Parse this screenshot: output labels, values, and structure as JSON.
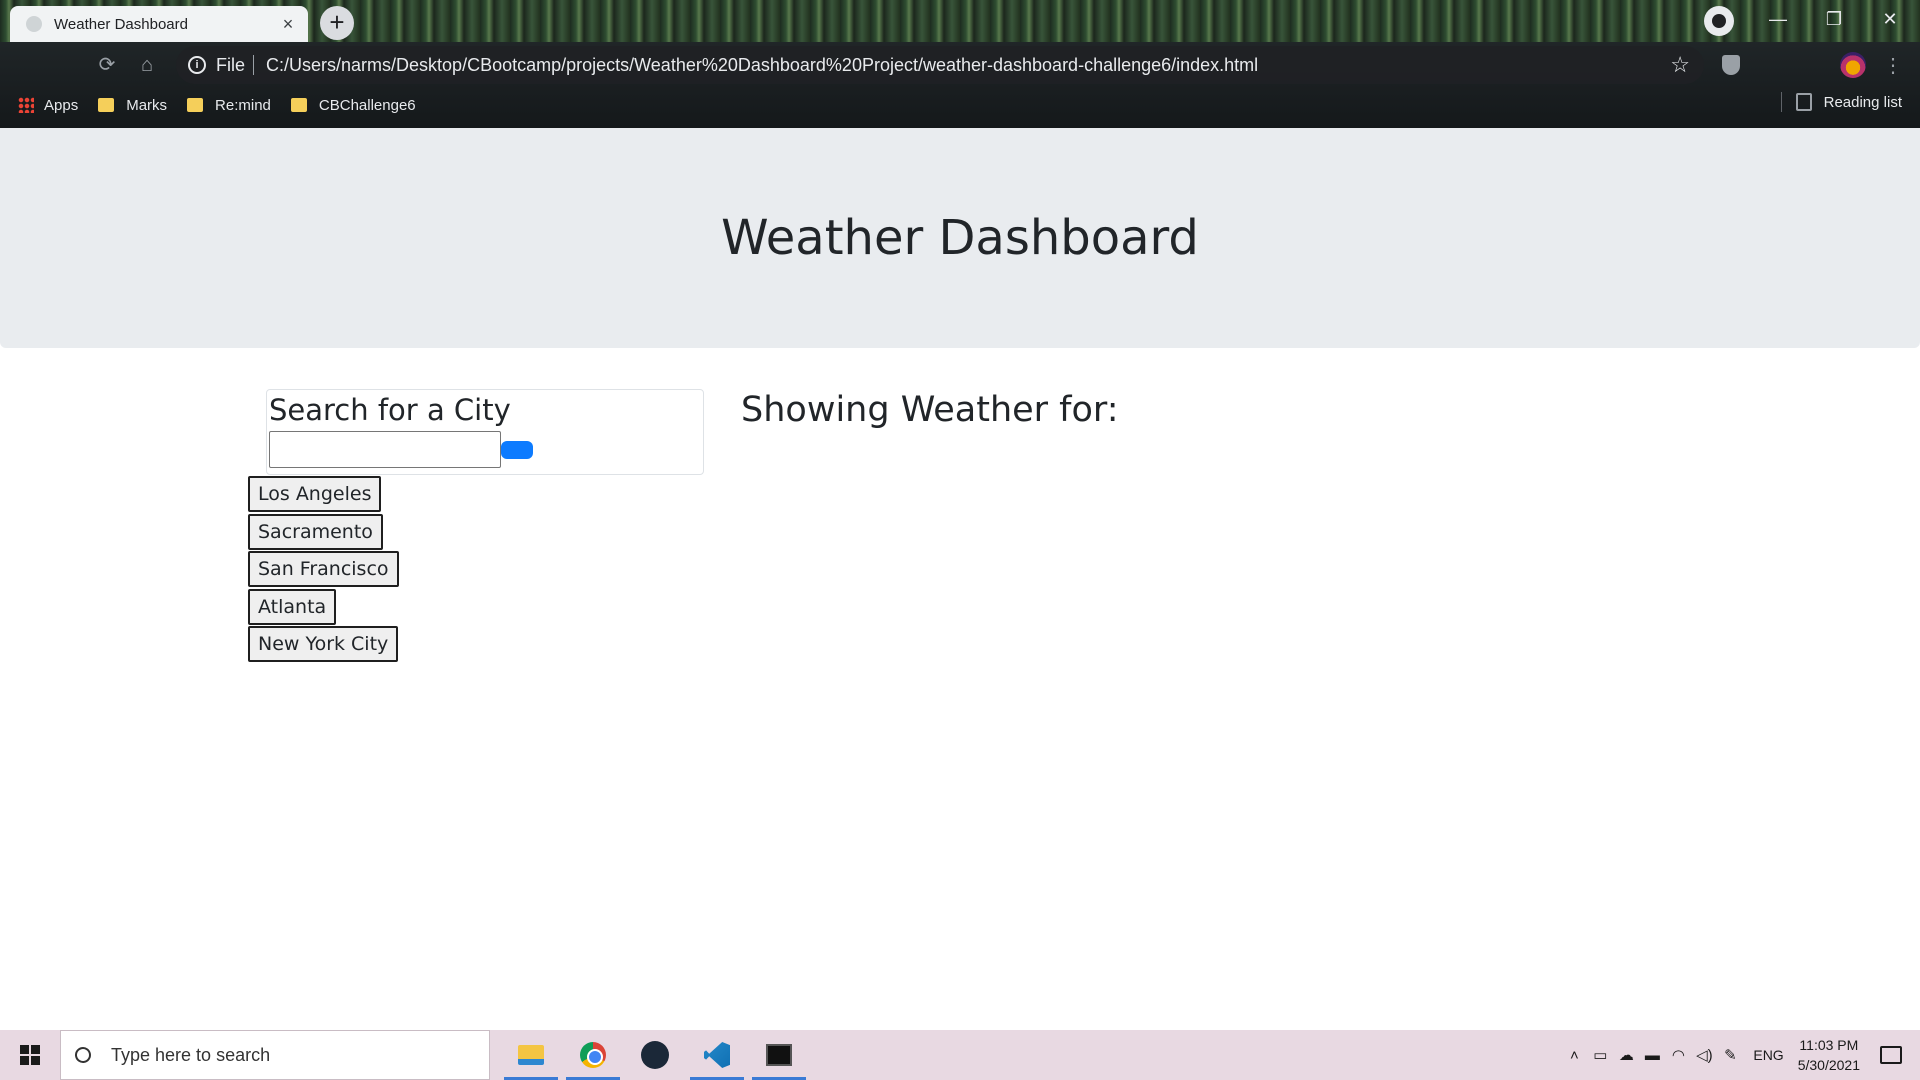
{
  "browser": {
    "tab_title": "Weather Dashboard",
    "tab_close": "×",
    "new_tab": "+",
    "scheme_label": "File",
    "url": "C:/Users/narms/Desktop/CBootcamp/projects/Weather%20Dashboard%20Project/weather-dashboard-challenge6/index.html",
    "bookmarks": [
      "Apps",
      "Marks",
      "Re:mind",
      "CBChallenge6"
    ],
    "reading_list": "Reading list",
    "window_controls": {
      "minimize": "—",
      "restore": "❐",
      "close": "✕"
    }
  },
  "page": {
    "title": "Weather Dashboard",
    "search": {
      "heading": "Search for a City",
      "input_value": "",
      "button_label": ""
    },
    "cities": [
      "Los Angeles",
      "Sacramento",
      "San Francisco",
      "Atlanta",
      "New York City"
    ],
    "results_heading": "Showing Weather for:"
  },
  "taskbar": {
    "search_placeholder": "Type here to search",
    "language": "ENG",
    "time": "11:03 PM",
    "date": "5/30/2021",
    "apps": [
      "file-explorer-icon",
      "chrome-icon",
      "steam-icon",
      "vscode-icon",
      "terminal-icon"
    ]
  },
  "colors": {
    "jumbotron_bg": "#e9ecef",
    "search_button": "#0d7bff",
    "taskbar_bg": "#e8d9e2"
  }
}
